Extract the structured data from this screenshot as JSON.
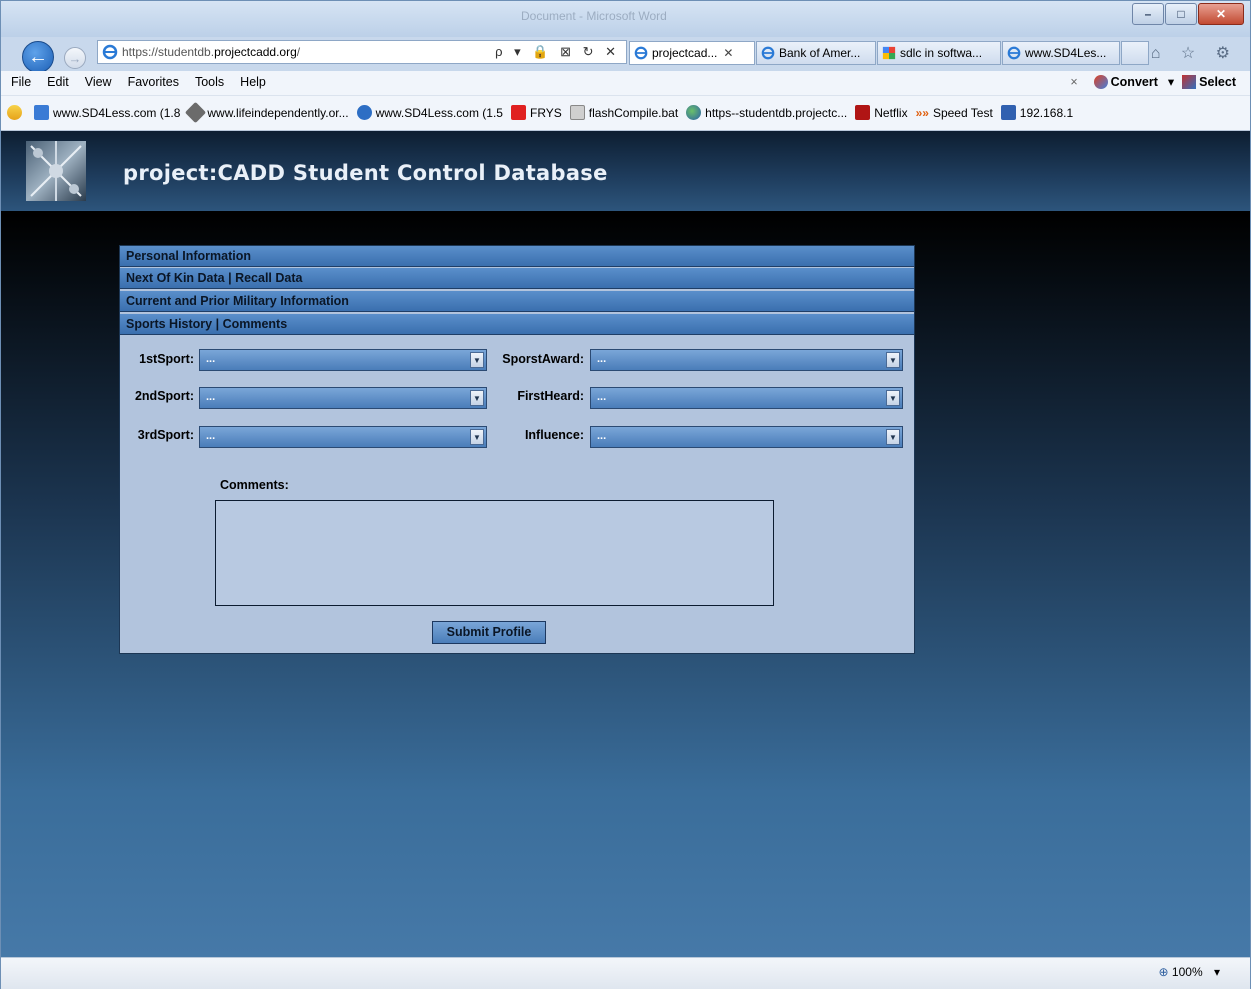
{
  "browser": {
    "window_title": "Document - Microsoft Word",
    "address_prefix": "https://studentdb.",
    "address_domain": "projectcadd.org",
    "address_suffix": "/",
    "address_tools": "ρ ▾ 🔒 ⊠ ↻ ✕",
    "tabs": [
      {
        "label": "projectcad...",
        "close": "✕"
      },
      {
        "label": "Bank of Amer..."
      },
      {
        "label": "sdlc in softwa..."
      },
      {
        "label": "www.SD4Les..."
      }
    ],
    "nav_icons": "⌂ ☆ ⚙",
    "back_glyph": "←",
    "forward_glyph": "→",
    "window_buttons": {
      "min": "–",
      "max": "□",
      "close": "✕"
    }
  },
  "menu": {
    "items": [
      "File",
      "Edit",
      "View",
      "Favorites",
      "Tools",
      "Help"
    ],
    "close_x": "×",
    "convert": "Convert",
    "convert_arrow": "▾",
    "select": "Select"
  },
  "favorites": {
    "items": [
      {
        "label": "www.SD4Less.com (1.8",
        "color": "#3a7bd5"
      },
      {
        "label": "www.lifeindependently.or...",
        "color": "#6b6b6b"
      },
      {
        "label": "www.SD4Less.com (1.5",
        "color": "#2d6ec4"
      },
      {
        "label": "FRYS",
        "color": "#e02020"
      },
      {
        "label": "flashCompile.bat",
        "color": "#8a8a8a"
      },
      {
        "label": "https--studentdb.projectc...",
        "color": "#2a5fa8"
      },
      {
        "label": "Netflix",
        "color": "#b01515"
      },
      {
        "label": "Speed Test",
        "color": "#e06010"
      },
      {
        "label": "192.168.1",
        "color": "#3060b0"
      }
    ],
    "more": "»»"
  },
  "app": {
    "title": "project:CADD Student Control Database",
    "sections": [
      "Personal Information",
      "Next Of Kin Data | Recall Data",
      "Current and Prior Military Information",
      "Sports History | Comments"
    ],
    "fields": {
      "sport1": {
        "label": "1stSport:",
        "value": "..."
      },
      "sport2": {
        "label": "2ndSport:",
        "value": "..."
      },
      "sport3": {
        "label": "3rdSport:",
        "value": "..."
      },
      "award": {
        "label": "SporstAward:",
        "value": "..."
      },
      "heard": {
        "label": "FirstHeard:",
        "value": "..."
      },
      "influence": {
        "label": "Influence:",
        "value": "..."
      }
    },
    "comments_label": "Comments:",
    "comments_value": "",
    "submit_label": "Submit Profile",
    "dropdown_arrow": "▼"
  },
  "status": {
    "zoom": "100%",
    "zoom_arrow": "▾"
  }
}
